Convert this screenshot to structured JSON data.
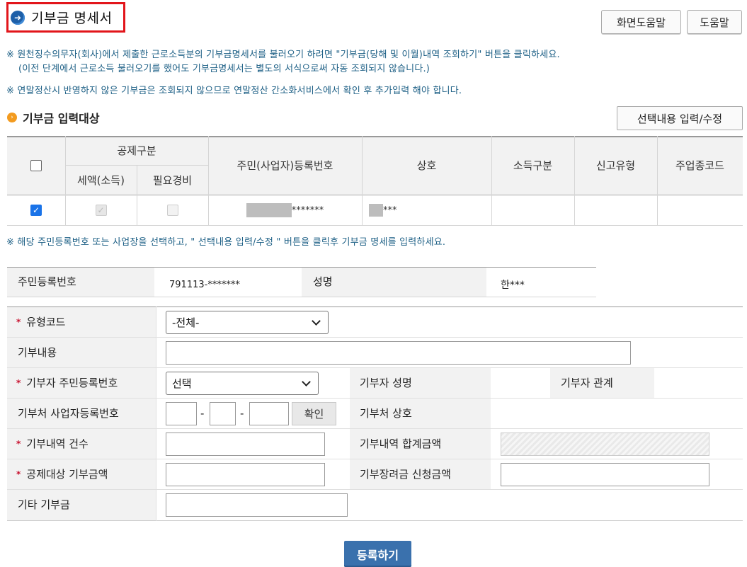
{
  "page": {
    "title": "기부금 명세서",
    "screen_help_label": "화면도움말",
    "help_label": "도움말"
  },
  "notices": {
    "line1": "※ 원천징수의무자(회사)에서 제출한 근로소득분의 기부금명세서를 불러오기 하려면 \"기부금(당해 및 이월)내역 조회하기\" 버튼을 클릭하세요.",
    "line2": "(이전 단계에서 근로소득 불러오기를 했어도 기부금명세서는 별도의 서식으로써 자동 조회되지 않습니다.)",
    "line3": "※ 연말정산시 반영하지 않은 기부금은 조회되지 않으므로 연말정산 간소화서비스에서 확인 후 추가입력 해야 합니다.",
    "line4": "※ 해당 주민등록번호 또는 사업장을 선택하고, \" 선택내용 입력/수정 \" 버튼을 클릭후 기부금 명세를 입력하세요."
  },
  "target_section": {
    "title": "기부금 입력대상",
    "edit_button": "선택내용 입력/수정",
    "headers": {
      "deduction_group": "공제구분",
      "tax_credit": "세액(소득)",
      "expenses": "필요경비",
      "reg_no": "주민(사업자)등록번호",
      "company": "상호",
      "income_type": "소득구분",
      "report_type": "신고유형",
      "industry_code": "주업종코드"
    },
    "rows": [
      {
        "selected": true,
        "tax_credit_checked": true,
        "expenses_checked": false,
        "reg_no_suffix": "*******",
        "company_suffix": "***",
        "income_type": "",
        "report_type": "",
        "industry_code": ""
      }
    ]
  },
  "person": {
    "reg_no_label": "주민등록번호",
    "reg_no_value": "791113-*******",
    "name_label": "성명",
    "name_value": "한***"
  },
  "form": {
    "type_code_label": "유형코드",
    "type_code_value": "-전체-",
    "content_label": "기부내용",
    "donor_reg_label": "기부자 주민등록번호",
    "donor_reg_value": "선택",
    "donor_name_label": "기부자 성명",
    "donor_relation_label": "기부자 관계",
    "recipient_biz_label": "기부처 사업자등록번호",
    "dash1": "-",
    "dash2": "-",
    "confirm_button": "확인",
    "recipient_name_label": "기부처 상호",
    "count_label": "기부내역 건수",
    "total_label": "기부내역 합계금액",
    "deductible_label": "공제대상 기부금액",
    "incentive_label": "기부장려금 신청금액",
    "other_label": "기타 기부금"
  },
  "submit_label": "등록하기",
  "colors": {
    "accent_blue": "#3a71ad",
    "notice_text": "#1e6086",
    "title_border": "#e2151b",
    "required_star": "#c8102e"
  }
}
